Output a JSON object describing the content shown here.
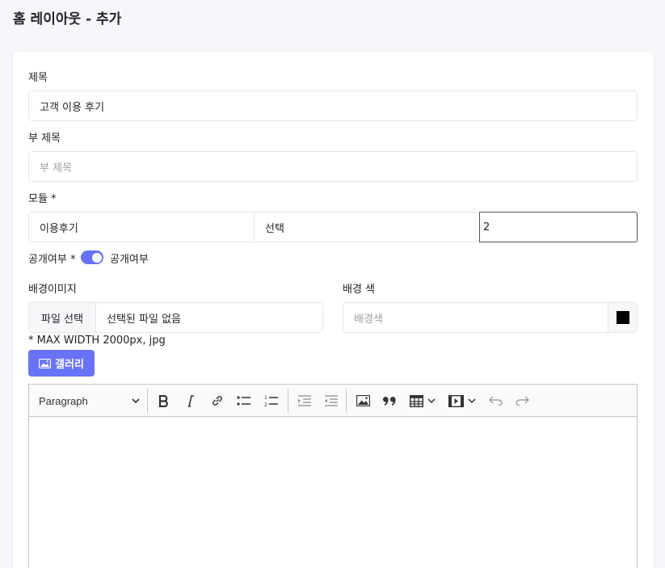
{
  "page": {
    "title": "홈 레이아웃 - 추가"
  },
  "form": {
    "title_label": "제목",
    "title_value": "고객 이용 후기",
    "subtitle_label": "부 제목",
    "subtitle_placeholder": "부 제목",
    "module_label": "모듈 *",
    "module_type": "이용후기",
    "module_select": "선택",
    "module_count": "2",
    "public_label": "공개여부 *",
    "public_toggle_label": "공개여부",
    "public_on": true,
    "bg_image_label": "배경이미지",
    "file_button": "파일 선택",
    "file_name": "선택된 파일 없음",
    "bg_color_label": "배경 색",
    "bg_color_placeholder": "배경색",
    "bg_color_value": "#000000",
    "image_hint": "* MAX WIDTH 2000px, jpg",
    "gallery_button": "갤러리"
  },
  "editor": {
    "paragraph_select": "Paragraph",
    "tools": [
      "bold-icon",
      "italic-icon",
      "link-icon",
      "bulleted-list-icon",
      "numbered-list-icon",
      "increase-indent-icon",
      "decrease-indent-icon",
      "image-icon",
      "blockquote-icon",
      "table-icon",
      "media-icon",
      "undo-icon",
      "redo-icon"
    ]
  },
  "colors": {
    "accent": "#6872f7"
  }
}
